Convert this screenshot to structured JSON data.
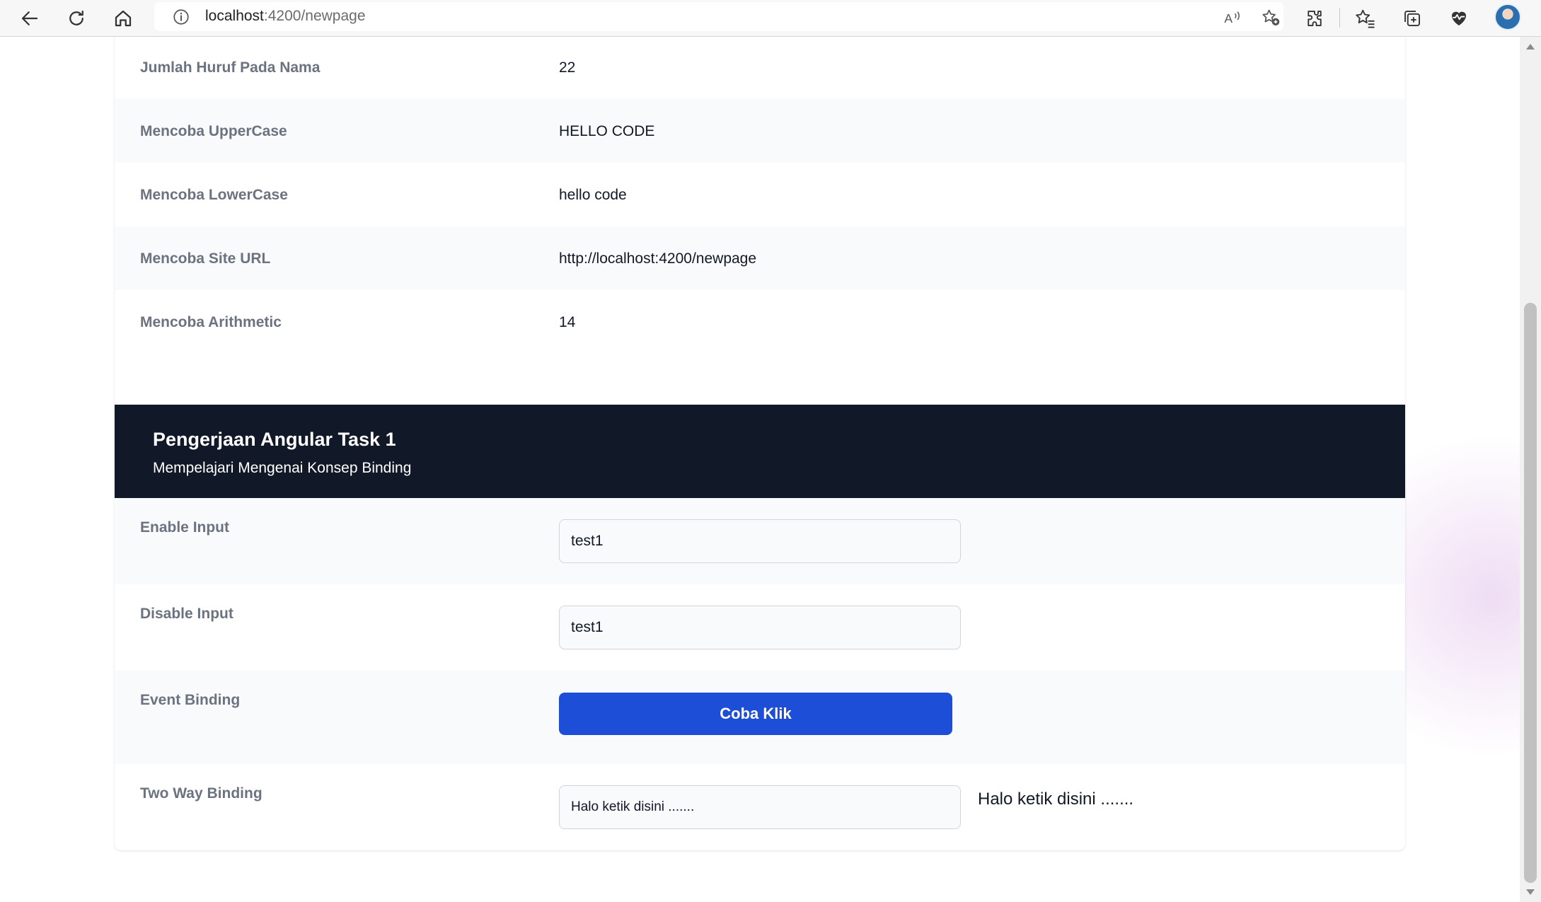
{
  "browser": {
    "url_host": "localhost",
    "url_rest": ":4200/newpage",
    "colors": {
      "chrome_bg": "#f7f7f7",
      "address_bg": "#ffffff"
    },
    "icons": [
      "back-arrow-icon",
      "refresh-icon",
      "home-icon",
      "info-icon",
      "read-aloud-icon",
      "add-favorite-icon",
      "extensions-icon",
      "favorites-icon",
      "collections-icon",
      "browser-essentials-icon",
      "profile-avatar"
    ]
  },
  "properties": [
    {
      "label": "Jumlah Huruf Pada Nama",
      "value": "22"
    },
    {
      "label": "Mencoba UpperCase",
      "value": "HELLO CODE"
    },
    {
      "label": "Mencoba LowerCase",
      "value": "hello code"
    },
    {
      "label": "Mencoba Site URL",
      "value": "http://localhost:4200/newpage"
    },
    {
      "label": "Mencoba Arithmetic",
      "value": "14"
    }
  ],
  "section": {
    "title": "Pengerjaan Angular Task 1",
    "subtitle": "Mempelajari Mengenai Konsep Binding"
  },
  "binding": {
    "enable_input": {
      "label": "Enable Input",
      "value": "test1"
    },
    "disable_input": {
      "label": "Disable Input",
      "value": "test1"
    },
    "event_binding": {
      "label": "Event Binding",
      "button_label": "Coba Klik"
    },
    "two_way_binding": {
      "label": "Two Way Binding",
      "value": "Halo ketik disini .......",
      "echo": "Halo ketik disini ......."
    }
  },
  "theme": {
    "header_bg": "#111827",
    "button_bg": "#1d4ed8",
    "label_color": "#6b7280",
    "row_alt_bg": "#f9fafb"
  }
}
